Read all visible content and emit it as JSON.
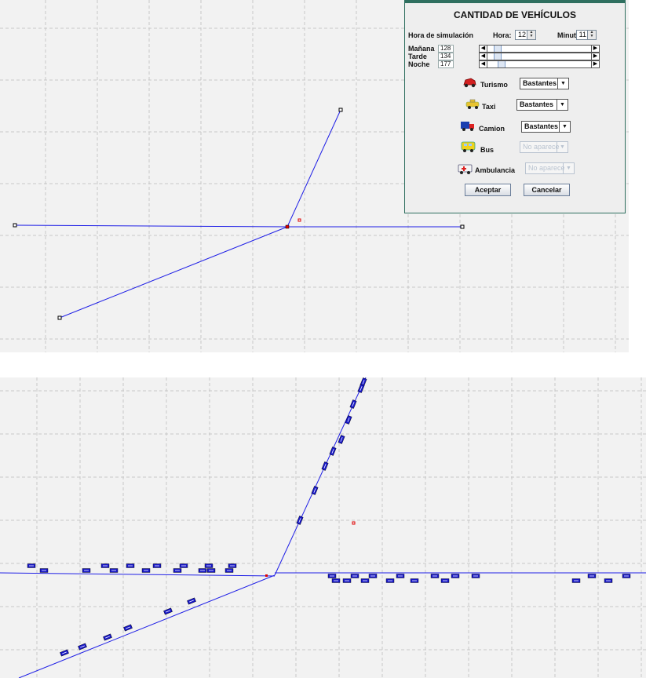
{
  "dialog": {
    "title": "CANTIDAD DE VEHÍCULOS",
    "time": {
      "label": "Hora de simulación",
      "hora_label": "Hora:",
      "hora_value": "12",
      "minutos_label": "Minutos:",
      "minutos_value": "11"
    },
    "periods": [
      {
        "label": "Mañana",
        "value": "128"
      },
      {
        "label": "Tarde",
        "value": "134"
      },
      {
        "label": "Noche",
        "value": "177"
      }
    ],
    "vehicles": [
      {
        "label": "Turismo",
        "selection": "Bastantes",
        "enabled": true,
        "icon": "car-icon"
      },
      {
        "label": "Taxi",
        "selection": "Bastantes",
        "enabled": true,
        "icon": "taxi-icon"
      },
      {
        "label": "Camion",
        "selection": "Bastantes",
        "enabled": true,
        "icon": "truck-icon"
      },
      {
        "label": "Bus",
        "selection": "No aparece",
        "enabled": false,
        "icon": "bus-icon"
      },
      {
        "label": "Ambulancia",
        "selection": "No aparece",
        "enabled": false,
        "icon": "ambulance-icon"
      }
    ],
    "buttons": {
      "accept": "Aceptar",
      "cancel": "Cancelar"
    }
  },
  "colors": {
    "road": "#1f1fe6",
    "vehicle": "#1616c8",
    "grid": "#c8c8c8",
    "node": "#000000",
    "marker": "#e00000",
    "dialog_border": "#2f6f5f"
  }
}
